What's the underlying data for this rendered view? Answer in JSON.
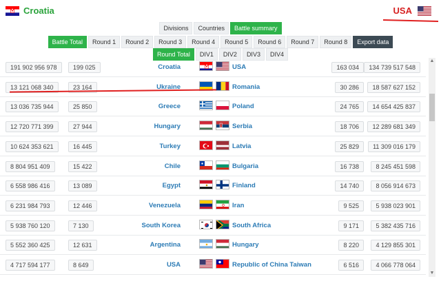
{
  "header": {
    "left_team": "Croatia",
    "right_team": "USA",
    "left_flag_icon": "croatia-flag-icon",
    "right_flag_icon": "usa-flag-icon"
  },
  "view_tabs": [
    {
      "label": "Divisions",
      "active": false
    },
    {
      "label": "Countries",
      "active": false
    },
    {
      "label": "Battle summary",
      "active": true
    }
  ],
  "round_tabs": [
    {
      "label": "Battle Total",
      "active": true
    },
    {
      "label": "Round 1",
      "active": false
    },
    {
      "label": "Round 2",
      "active": false
    },
    {
      "label": "Round 3",
      "active": false
    },
    {
      "label": "Round 4",
      "active": false
    },
    {
      "label": "Round 5",
      "active": false
    },
    {
      "label": "Round 6",
      "active": false
    },
    {
      "label": "Round 7",
      "active": false
    },
    {
      "label": "Round 8",
      "active": false
    },
    {
      "label": "Export data",
      "active": false,
      "dark": true
    }
  ],
  "div_tabs": [
    {
      "label": "Round Total",
      "active": true
    },
    {
      "label": "DIV1",
      "active": false
    },
    {
      "label": "DIV2",
      "active": false
    },
    {
      "label": "DIV3",
      "active": false
    },
    {
      "label": "DIV4",
      "active": false
    }
  ],
  "colors": {
    "accent_green": "#2eb34a",
    "link_blue": "#2c7bb5",
    "highlight_red": "#e02020"
  },
  "rows": [
    {
      "left_damage": "191 902 956 978",
      "left_hits": "199 025",
      "team_a": "Croatia",
      "flag_a": "croatia",
      "flag_b": "usa",
      "team_b": "USA",
      "right_hits": "163 034",
      "right_damage": "134 739 517 548"
    },
    {
      "left_damage": "13 121 068 340",
      "left_hits": "23 164",
      "team_a": "Ukraine",
      "flag_a": "ukraine",
      "flag_b": "romania",
      "team_b": "Romania",
      "right_hits": "30 286",
      "right_damage": "18 587 627 152"
    },
    {
      "left_damage": "13 036 735 944",
      "left_hits": "25 850",
      "team_a": "Greece",
      "flag_a": "greece",
      "flag_b": "poland",
      "team_b": "Poland",
      "right_hits": "24 765",
      "right_damage": "14 654 425 837"
    },
    {
      "left_damage": "12 720 771 399",
      "left_hits": "27 944",
      "team_a": "Hungary",
      "flag_a": "hungary",
      "flag_b": "serbia",
      "team_b": "Serbia",
      "right_hits": "18 706",
      "right_damage": "12 289 681 349"
    },
    {
      "left_damage": "10 624 353 621",
      "left_hits": "16 445",
      "team_a": "Turkey",
      "flag_a": "turkey",
      "flag_b": "latvia",
      "team_b": "Latvia",
      "right_hits": "25 829",
      "right_damage": "11 309 016 179"
    },
    {
      "left_damage": "8 804 951 409",
      "left_hits": "15 422",
      "team_a": "Chile",
      "flag_a": "chile",
      "flag_b": "bulgaria",
      "team_b": "Bulgaria",
      "right_hits": "16 738",
      "right_damage": "8 245 451 598"
    },
    {
      "left_damage": "6 558 986 416",
      "left_hits": "13 089",
      "team_a": "Egypt",
      "flag_a": "egypt",
      "flag_b": "finland",
      "team_b": "Finland",
      "right_hits": "14 740",
      "right_damage": "8 056 914 673"
    },
    {
      "left_damage": "6 231 984 793",
      "left_hits": "12 446",
      "team_a": "Venezuela",
      "flag_a": "venezuela",
      "flag_b": "iran",
      "team_b": "Iran",
      "right_hits": "9 525",
      "right_damage": "5 938 023 901"
    },
    {
      "left_damage": "5 938 760 120",
      "left_hits": "7 130",
      "team_a": "South Korea",
      "flag_a": "south-korea",
      "flag_b": "south-africa",
      "team_b": "South Africa",
      "right_hits": "9 171",
      "right_damage": "5 382 435 716"
    },
    {
      "left_damage": "5 552 360 425",
      "left_hits": "12 631",
      "team_a": "Argentina",
      "flag_a": "argentina",
      "flag_b": "hungary",
      "team_b": "Hungary",
      "right_hits": "8 220",
      "right_damage": "4 129 855 301"
    },
    {
      "left_damage": "4 717 594 177",
      "left_hits": "8 649",
      "team_a": "USA",
      "flag_a": "usa",
      "flag_b": "taiwan",
      "team_b": "Republic of China Taiwan",
      "right_hits": "6 516",
      "right_damage": "4 066 778 064"
    }
  ]
}
